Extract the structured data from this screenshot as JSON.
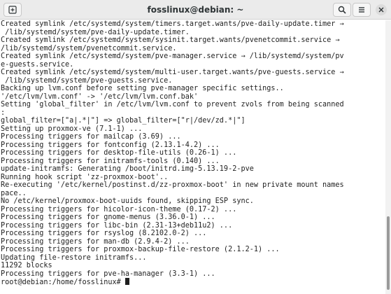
{
  "window": {
    "title": "fosslinux@debian: ~",
    "new_tab_icon": "new-tab-icon",
    "search_icon": "search-icon",
    "menu_icon": "hamburger-menu-icon",
    "close_icon": "close-icon"
  },
  "terminal": {
    "lines": [
      "Created symlink /etc/systemd/system/timers.target.wants/pve-daily-update.timer →",
      " /lib/systemd/system/pve-daily-update.timer.",
      "Created symlink /etc/systemd/system/sysinit.target.wants/pvenetcommit.service →",
      "/lib/systemd/system/pvenetcommit.service.",
      "Created symlink /etc/systemd/system/pve-manager.service → /lib/systemd/system/pv",
      "e-guests.service.",
      "Created symlink /etc/systemd/system/multi-user.target.wants/pve-guests.service →",
      " /lib/systemd/system/pve-guests.service.",
      "Backing up lvm.conf before setting pve-manager specific settings..",
      "'/etc/lvm/lvm.conf' -> '/etc/lvm/lvm.conf.bak'",
      "Setting 'global_filter' in /etc/lvm/lvm.conf to prevent zvols from being scanned",
      ":",
      "global_filter=[\"a|.*|\"] => global_filter=[\"r|/dev/zd.*|\"]",
      "Setting up proxmox-ve (7.1-1) ...",
      "Processing triggers for mailcap (3.69) ...",
      "Processing triggers for fontconfig (2.13.1-4.2) ...",
      "Processing triggers for desktop-file-utils (0.26-1) ...",
      "Processing triggers for initramfs-tools (0.140) ...",
      "update-initramfs: Generating /boot/initrd.img-5.13.19-2-pve",
      "Running hook script 'zz-proxmox-boot'..",
      "Re-executing '/etc/kernel/postinst.d/zz-proxmox-boot' in new private mount names",
      "pace..",
      "No /etc/kernel/proxmox-boot-uuids found, skipping ESP sync.",
      "Processing triggers for hicolor-icon-theme (0.17-2) ...",
      "Processing triggers for gnome-menus (3.36.0-1) ...",
      "Processing triggers for libc-bin (2.31-13+deb11u2) ...",
      "Processing triggers for rsyslog (8.2102.0-2) ...",
      "Processing triggers for man-db (2.9.4-2) ...",
      "Processing triggers for proxmox-backup-file-restore (2.1.2-1) ...",
      "Updating file-restore initramfs...",
      "11292 blocks",
      "Processing triggers for pve-ha-manager (3.3-1) ..."
    ],
    "prompt": "root@debian:/home/fosslinux#"
  }
}
